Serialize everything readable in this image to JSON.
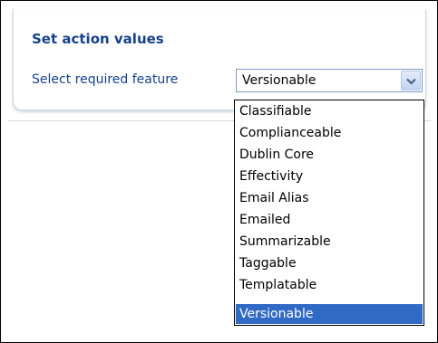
{
  "panel": {
    "title": "Set action values",
    "field_label": "Select required feature",
    "select": {
      "value": "Versionable",
      "arrow_icon": "chevron-down-icon"
    }
  },
  "dropdown": {
    "options": [
      "Classifiable",
      "Complianceable",
      "Dublin Core",
      "Effectivity",
      "Email Alias",
      "Emailed",
      "Summarizable",
      "Taggable",
      "Templatable",
      "Versionable"
    ],
    "selected": "Versionable"
  },
  "colors": {
    "heading": "#15428b",
    "selection": "#316ac5",
    "select_border": "#7f9db9"
  }
}
